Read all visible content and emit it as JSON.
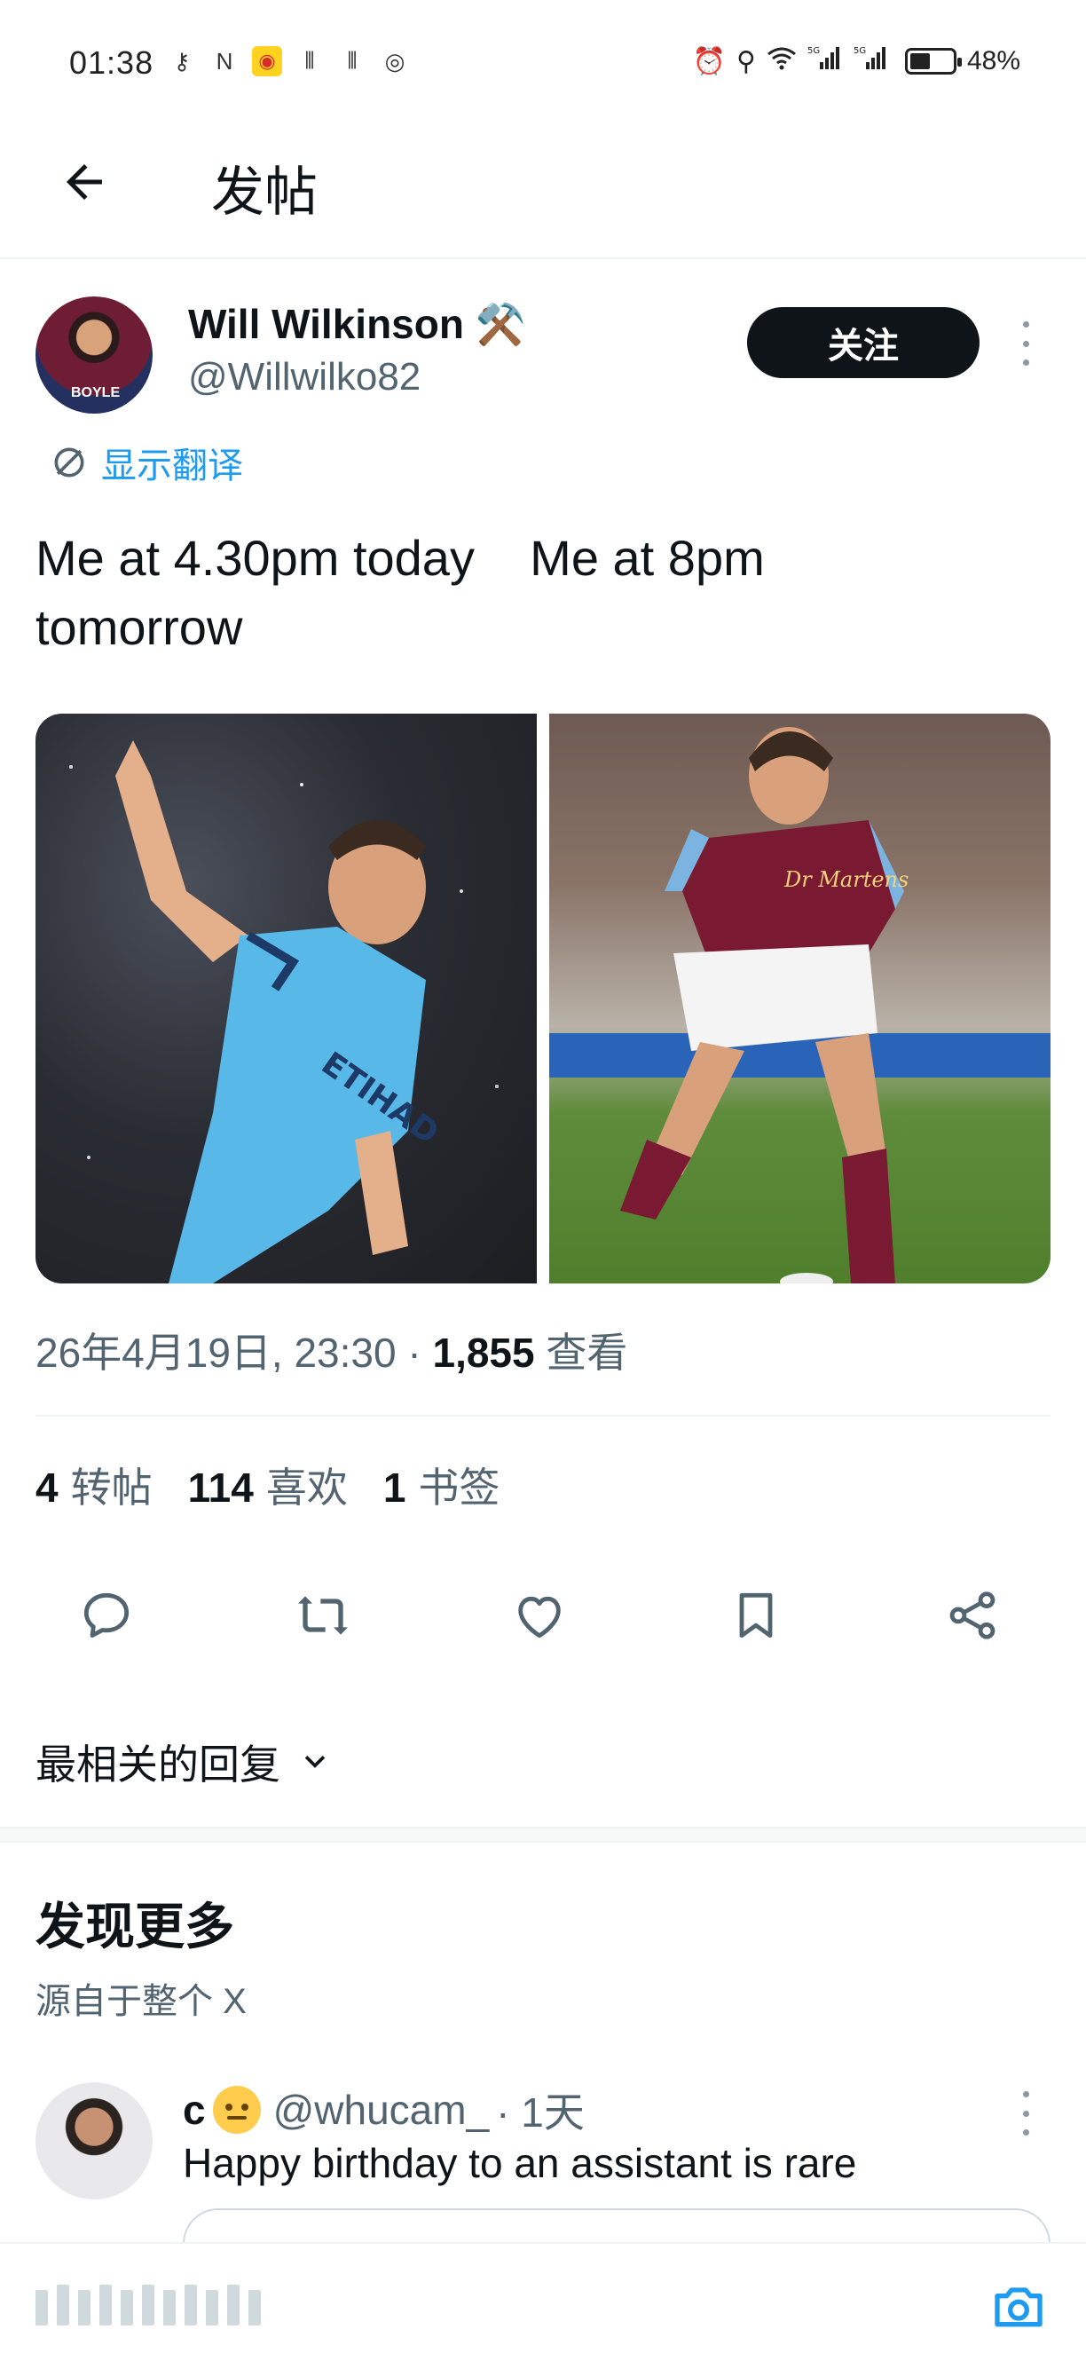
{
  "status_bar": {
    "time": "01:38",
    "battery": "48%",
    "battery_level": 0.48,
    "network": "5G",
    "icons_left": [
      "key-icon",
      "nfc-icon",
      "weibo-icon",
      "app-icon",
      "app-icon",
      "instagram-icon"
    ],
    "icons_right": [
      "alarm-icon",
      "location-icon",
      "wifi-icon",
      "signal-icon",
      "signal-icon",
      "battery-icon"
    ]
  },
  "header": {
    "title": "发帖"
  },
  "post": {
    "author_name": "Will Wilkinson",
    "author_emoji": "⚒️",
    "author_handle": "@Willwilko82",
    "avatar_tag": "BOYLE",
    "follow_label": "关注",
    "translate_label": "显示翻译",
    "text": "Me at 4.30pm today    Me at 8pm\ntomorrow",
    "timestamp": "26年4月19日, 23:30",
    "separator": "·",
    "views_count": "1,855",
    "views_label": "查看",
    "stats": {
      "reposts_count": "4",
      "reposts_label": "转帖",
      "likes_count": "114",
      "likes_label": "喜欢",
      "bookmarks_count": "1",
      "bookmarks_label": "书签"
    }
  },
  "replies": {
    "sort_label": "最相关的回复"
  },
  "discover": {
    "title": "发现更多",
    "subtitle": "源自于整个 X"
  },
  "recommended": {
    "name": "c",
    "handle": "@whucam_",
    "time": "· 1天",
    "text": "Happy birthday to an assistant is rare"
  },
  "colors": {
    "accent": "#1d9bf0",
    "text_primary": "#0f1419",
    "text_secondary": "#536471",
    "follow_bg": "#0f1419"
  }
}
